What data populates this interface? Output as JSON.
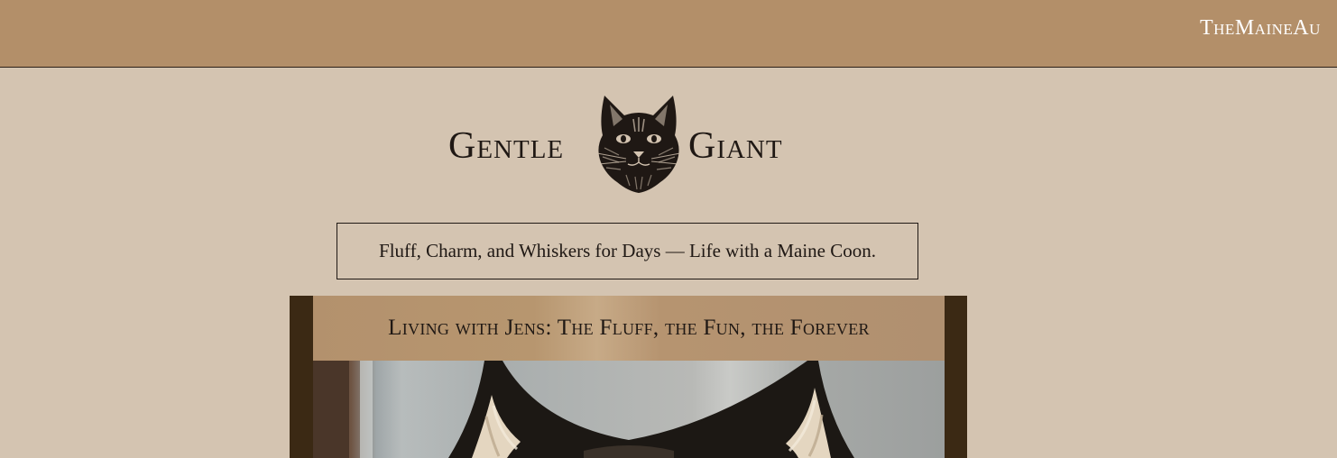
{
  "topbar": {
    "marquee_text": "TheMaineAu"
  },
  "logo": {
    "word_left": "Gentle",
    "word_right": "Giant",
    "icon": "cat-head-icon"
  },
  "tagline": "Fluff, Charm, and Whiskers for Days — Life with a Maine Coon.",
  "post": {
    "title": "Living with Jens: The Fluff, the Fun, the Forever",
    "image": "maine-coon-ears-photo"
  },
  "colors": {
    "topbar": "#b38f69",
    "background": "#d4c4b1",
    "post_frame": "#3b2914",
    "text": "#1f1814"
  }
}
